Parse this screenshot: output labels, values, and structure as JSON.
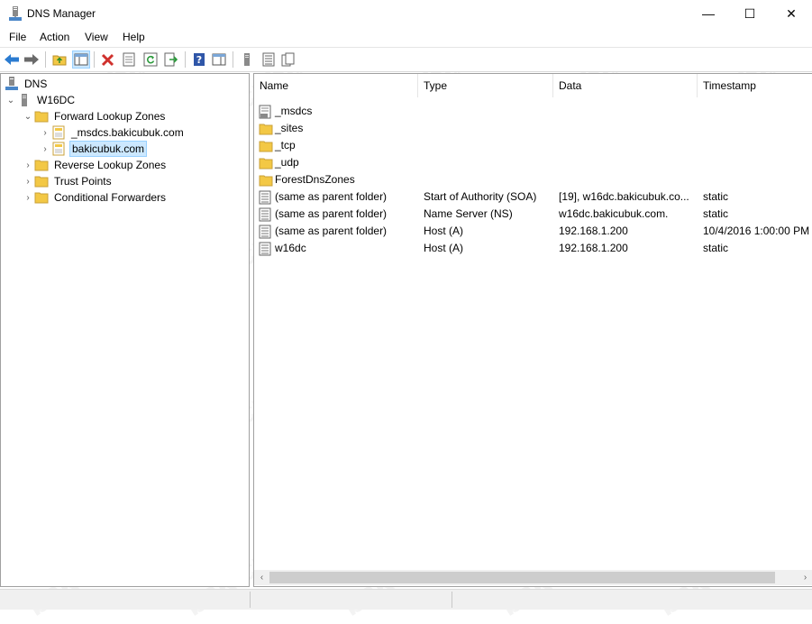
{
  "window": {
    "title": "DNS Manager",
    "controls": {
      "minimize": "—",
      "maximize": "☐",
      "close": "✕"
    }
  },
  "menu": [
    "File",
    "Action",
    "View",
    "Help"
  ],
  "toolbar": {
    "icons": [
      "back-arrow-icon",
      "forward-arrow-icon",
      "up-folder-icon",
      "show-hide-tree-icon",
      "delete-icon",
      "properties-icon",
      "refresh-icon",
      "export-list-icon",
      "help-icon",
      "show-hide-action-pane-icon",
      "server-icon",
      "list-icon",
      "copy-icon"
    ]
  },
  "tree": {
    "root": "DNS",
    "server": "W16DC",
    "forward_zones": "Forward Lookup Zones",
    "msdcs_zone": "_msdcs.bakicubuk.com",
    "selected_zone": "bakicubuk.com",
    "reverse_zones": "Reverse Lookup Zones",
    "trust_points": "Trust Points",
    "conditional_forwarders": "Conditional Forwarders"
  },
  "list": {
    "columns": [
      "Name",
      "Type",
      "Data",
      "Timestamp"
    ],
    "rows": [
      {
        "icon": "delegation-icon",
        "name": "_msdcs",
        "type": "",
        "data": "",
        "timestamp": ""
      },
      {
        "icon": "folder-icon",
        "name": "_sites",
        "type": "",
        "data": "",
        "timestamp": ""
      },
      {
        "icon": "folder-icon",
        "name": "_tcp",
        "type": "",
        "data": "",
        "timestamp": ""
      },
      {
        "icon": "folder-icon",
        "name": "_udp",
        "type": "",
        "data": "",
        "timestamp": ""
      },
      {
        "icon": "folder-icon",
        "name": "ForestDnsZones",
        "type": "",
        "data": "",
        "timestamp": ""
      },
      {
        "icon": "record-icon",
        "name": "(same as parent folder)",
        "type": "Start of Authority (SOA)",
        "data": "[19], w16dc.bakicubuk.co...",
        "timestamp": "static"
      },
      {
        "icon": "record-icon",
        "name": "(same as parent folder)",
        "type": "Name Server (NS)",
        "data": "w16dc.bakicubuk.com.",
        "timestamp": "static"
      },
      {
        "icon": "record-icon",
        "name": "(same as parent folder)",
        "type": "Host (A)",
        "data": "192.168.1.200",
        "timestamp": "10/4/2016 1:00:00 PM"
      },
      {
        "icon": "record-icon",
        "name": "w16dc",
        "type": "Host (A)",
        "data": "192.168.1.200",
        "timestamp": "static"
      }
    ]
  },
  "watermark_text": "bakicubuk",
  "colors": {
    "folder": "#f3c845",
    "selection": "#cce8ff",
    "back_arrow": "#2b7bd0",
    "delete": "#d0312d"
  }
}
